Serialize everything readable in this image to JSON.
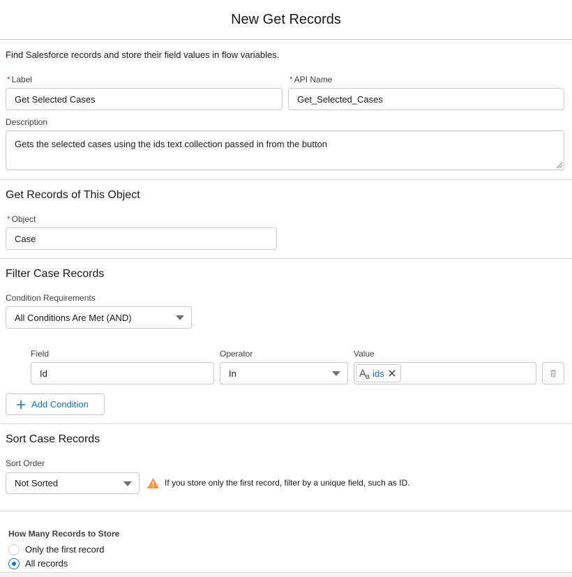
{
  "header": {
    "title": "New Get Records"
  },
  "intro": "Find Salesforce records and store their field values in flow variables.",
  "label_field": {
    "label": "Label",
    "value": "Get Selected Cases"
  },
  "api_name_field": {
    "label": "API Name",
    "value": "Get_Selected_Cases"
  },
  "description_field": {
    "label": "Description",
    "value": "Gets the selected cases using the ids text collection passed in from the button"
  },
  "get_records_section": {
    "title": "Get Records of This Object",
    "object_label": "Object",
    "object_value": "Case"
  },
  "filter_section": {
    "title": "Filter Case Records",
    "condition_label": "Condition Requirements",
    "condition_value": "All Conditions Are Met (AND)",
    "headers": {
      "field": "Field",
      "operator": "Operator",
      "value": "Value"
    },
    "row": {
      "field": "Id",
      "operator": "In",
      "value_pill": "ids"
    },
    "add_condition": "Add Condition"
  },
  "sort_section": {
    "title": "Sort Case Records",
    "sort_order_label": "Sort Order",
    "sort_order_value": "Not Sorted",
    "warning": "If you store only the first record, filter by a unique field, such as ID."
  },
  "store_section": {
    "title": "How Many Records to Store",
    "options": [
      "Only the first record",
      "All records"
    ],
    "selected_index": 1
  },
  "colors": {
    "accent": "#0176d3",
    "required": "#c23934",
    "warning": "#fe9339"
  }
}
